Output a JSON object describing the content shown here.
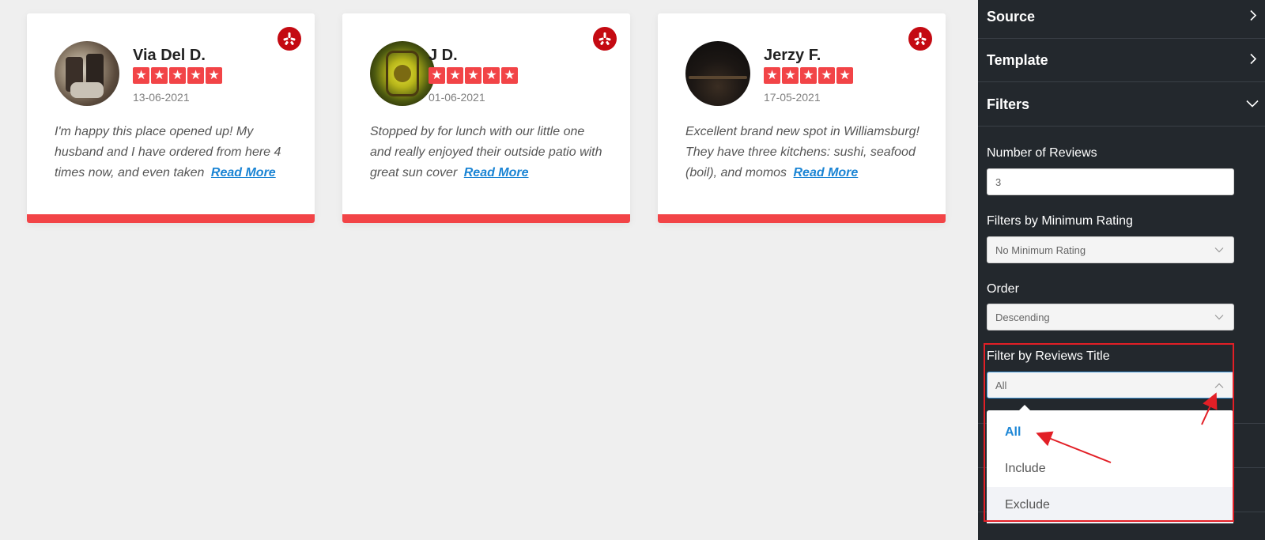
{
  "reviews": [
    {
      "name": "Via Del D.",
      "rating": 5,
      "date": "13-06-2021",
      "text": "I'm happy this place opened up! My husband and I have ordered from here 4 times now, and even taken",
      "read_more": "Read More"
    },
    {
      "name": "J D.",
      "rating": 5,
      "date": "01-06-2021",
      "text": "Stopped by for lunch with our little one and really enjoyed their outside patio with great sun cover",
      "read_more": "Read More"
    },
    {
      "name": "Jerzy F.",
      "rating": 5,
      "date": "17-05-2021",
      "text": "Excellent brand new spot in Williamsburg! They have three kitchens: sushi, seafood (boil), and momos",
      "read_more": "Read More"
    }
  ],
  "panel": {
    "sections": {
      "source": "Source",
      "template": "Template",
      "filters": "Filters"
    },
    "number_of_reviews": {
      "label": "Number of Reviews",
      "value": "3"
    },
    "min_rating": {
      "label": "Filters by Minimum Rating",
      "value": "No Minimum Rating"
    },
    "order": {
      "label": "Order",
      "value": "Descending"
    },
    "title_filter": {
      "label": "Filter by Reviews Title",
      "value": "All",
      "options": [
        "All",
        "Include",
        "Exclude"
      ],
      "selected": "All"
    }
  },
  "colors": {
    "accent_red": "#f24447",
    "yelp_red": "#c40a12",
    "link_blue": "#1a84d4",
    "panel_bg": "#23282d",
    "highlight": "#e21f26"
  },
  "icons": {
    "yelp": "yelp-icon",
    "star": "star-icon",
    "chevron_right": "chevron-right-icon",
    "chevron_down": "chevron-down-icon",
    "chevron_up": "chevron-up-icon"
  }
}
